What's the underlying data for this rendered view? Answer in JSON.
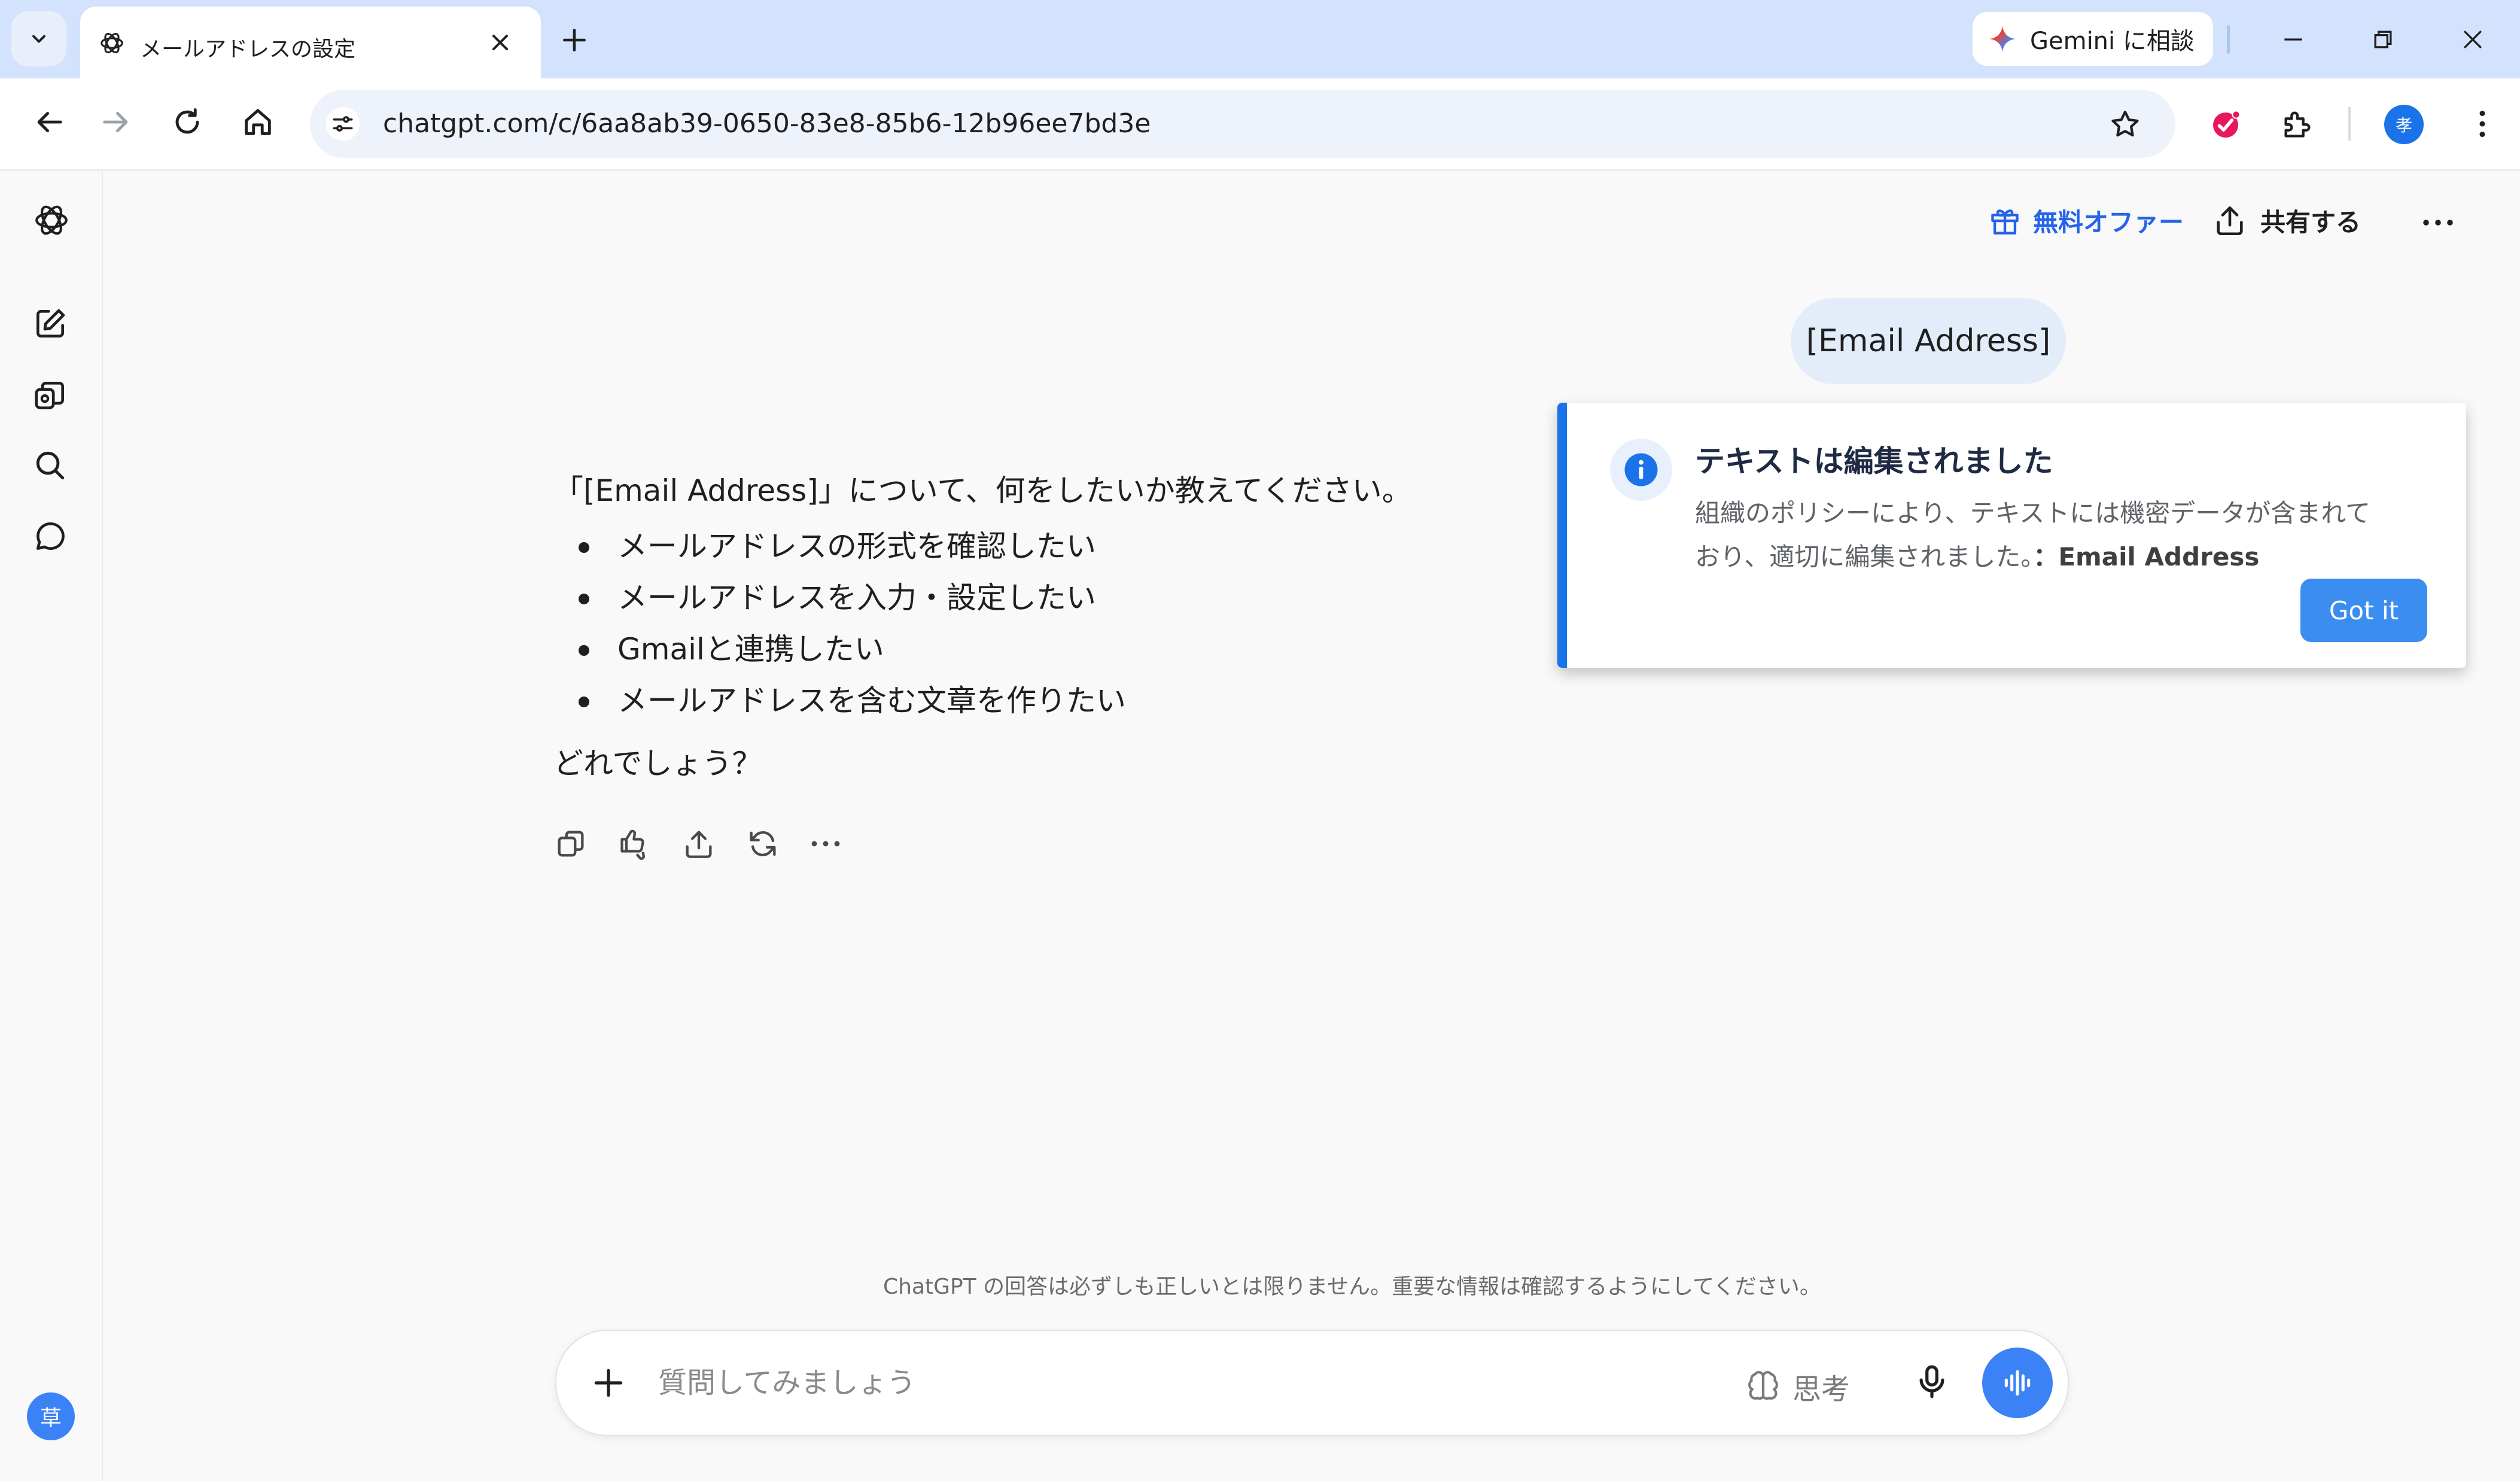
{
  "browser": {
    "tab_title": "メールアドレスの設定",
    "gemini_button": "Gemini に相談",
    "url": "chatgpt.com/c/6aa8ab39-0650-83e8-85b6-12b96ee7bd3e",
    "profile_initial": "孝"
  },
  "header": {
    "offer_label": "無料オファー",
    "share_label": "共有する"
  },
  "sidebar": {
    "user_initial": "草",
    "icons": [
      "openai-logo-icon",
      "new-chat-icon",
      "library-icon",
      "search-icon",
      "chat-bubble-icon"
    ]
  },
  "conversation": {
    "user_message": "[Email Address]",
    "assistant_intro": "「[Email Address]」について、何をしたいか教えてください。",
    "assistant_options": [
      "メールアドレスの形式を確認したい",
      "メールアドレスを入力・設定したい",
      "Gmailと連携したい",
      "メールアドレスを含む文章を作りたい"
    ],
    "assistant_outro": "どれでしょう？",
    "message_actions": [
      "copy-icon",
      "feedback-icon",
      "share-icon",
      "regenerate-icon",
      "more-icon"
    ]
  },
  "notice": {
    "title": "テキストは編集されました",
    "body_line1": "組織のポリシーにより、テキストには機密データが含まれて",
    "body_line2": "おり、適切に編集されました。",
    "redacted_type": "：Email Address",
    "button_label": "Got it"
  },
  "footer": {
    "disclaimer": "ChatGPT の回答は必ずしも正しいとは限りません。重要な情報は確認するようにしてください。"
  },
  "composer": {
    "placeholder": "質問してみましょう",
    "value": "",
    "think_label": "思考"
  },
  "colors": {
    "tabstrip_bg": "#d3e3fd",
    "accent_blue": "#3b82f6",
    "notice_border": "#1a73e8",
    "user_bubble": "#e3edfa"
  }
}
